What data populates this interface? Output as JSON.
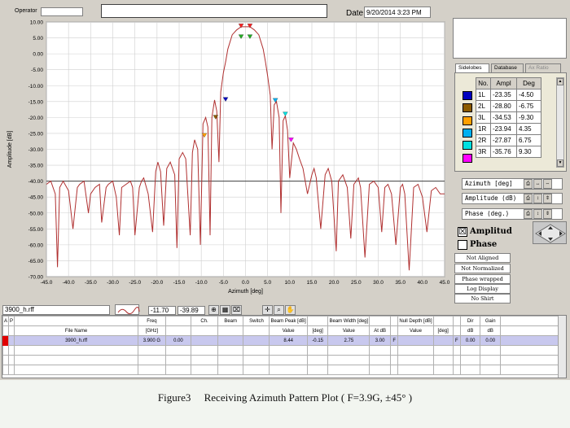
{
  "header": {
    "operator_label": "Operator",
    "operator_value": "",
    "title_value": "",
    "date_label": "Date",
    "date_value": "9/20/2014 3:23 PM"
  },
  "chart_data": {
    "type": "line",
    "xlabel": "Azimuth  [deg]",
    "ylabel": "Amplitude  [dB]",
    "xlim": [
      -45,
      45
    ],
    "ylim": [
      -70,
      10
    ],
    "xticks": [
      "-45.0",
      "-40.0",
      "-35.0",
      "-30.0",
      "-25.0",
      "-20.0",
      "-15.0",
      "-10.0",
      "-5.0",
      "0.0",
      "5.0",
      "10.0",
      "15.0",
      "20.0",
      "25.0",
      "30.0",
      "35.0",
      "40.0",
      "45.0"
    ],
    "yticks": [
      "10.00",
      "5.00",
      "0.00",
      "-5.00",
      "-10.00",
      "-15.00",
      "-20.00",
      "-25.00",
      "-30.00",
      "-35.00",
      "-40.00",
      "-45.00",
      "-50.00",
      "-55.00",
      "-60.00",
      "-65.00",
      "-70.00"
    ],
    "reference_line_y": -40,
    "grid": true,
    "series_color": "#b03030",
    "series": [
      {
        "x": [
          -45,
          -44,
          -43,
          -42.5,
          -42,
          -41.2,
          -40,
          -39,
          -38,
          -37.5,
          -36.5,
          -35.5,
          -35,
          -34,
          -33,
          -32.5,
          -31.5,
          -31,
          -30,
          -29.2,
          -28.5,
          -28,
          -27,
          -26,
          -25.5,
          -25,
          -24,
          -23.5,
          -23,
          -22,
          -21,
          -20.3,
          -19.8,
          -19.2,
          -18.5,
          -17.8,
          -17,
          -16,
          -15.5,
          -15,
          -14.2,
          -13.5,
          -12.5,
          -12,
          -11.5,
          -10.8,
          -10.2,
          -9.6,
          -9.0,
          -8.5,
          -8.0,
          -7.6,
          -7.0,
          -6.5,
          -6.0,
          -5.6,
          -5.0,
          -4.5,
          -4.0,
          -3.0,
          -2.0,
          -1.0,
          0,
          1.0,
          2.0,
          3.0,
          4.0,
          4.5,
          5.0,
          5.6,
          6.0,
          6.5,
          7.0,
          7.6,
          8.0,
          8.5,
          9.0,
          9.5,
          10.0,
          10.8,
          11.5,
          12.2,
          13,
          14,
          15,
          15.5,
          16,
          17,
          18,
          18.7,
          19.5,
          20.5,
          21,
          22,
          23,
          23.8,
          24.5,
          25.5,
          26,
          27,
          28,
          29,
          30,
          30.8,
          31.5,
          32.2,
          33,
          34,
          35,
          35.5,
          36,
          37,
          38,
          39,
          40,
          41,
          42,
          43,
          44,
          45
        ],
        "y": [
          -41,
          -40,
          -44,
          -67,
          -42,
          -40,
          -43,
          -55,
          -42,
          -41,
          -40,
          -50,
          -44,
          -42,
          -41,
          -53,
          -42,
          -41,
          -40,
          -45,
          -57,
          -42,
          -41,
          -40,
          -42,
          -57,
          -42,
          -40,
          -39,
          -44,
          -56,
          -37,
          -34,
          -37,
          -54,
          -36,
          -34,
          -38,
          -61,
          -33,
          -31,
          -33,
          -57,
          -31,
          -27,
          -30,
          -60,
          -22,
          -20,
          -23,
          -57,
          -20,
          -14.5,
          -18,
          -34,
          -12,
          -6,
          -2.5,
          1.5,
          6,
          7.5,
          8.5,
          8.5,
          8.5,
          7.5,
          6,
          1.5,
          -2.5,
          -7,
          -13,
          -30,
          -16,
          -15,
          -20,
          -50,
          -21,
          -19.5,
          -24,
          -39,
          -28,
          -30,
          -33,
          -36,
          -44,
          -38,
          -36,
          -39,
          -55,
          -38,
          -36,
          -40,
          -62,
          -40,
          -38,
          -42,
          -58,
          -41,
          -39,
          -42,
          -64,
          -41,
          -40,
          -42,
          -56,
          -42,
          -41,
          -44,
          -60,
          -42,
          -41,
          -44,
          -68,
          -42,
          -41,
          -45,
          -56,
          -43,
          -42,
          -44,
          -44
        ]
      }
    ],
    "markers": [
      {
        "x": -1.0,
        "y": 8.4,
        "color": "#ff2020",
        "shape": "down"
      },
      {
        "x": 1.0,
        "y": 8.4,
        "color": "#ff2020",
        "shape": "down"
      },
      {
        "x": -1.0,
        "y": 5.0,
        "color": "#22aa22",
        "shape": "down"
      },
      {
        "x": 1.0,
        "y": 5.0,
        "color": "#22aa22",
        "shape": "down"
      },
      {
        "x": -4.5,
        "y": -14.7,
        "color": "#0000c0",
        "shape": "down"
      },
      {
        "x": 6.75,
        "y": -15.0,
        "color": "#00b0f0",
        "shape": "down"
      },
      {
        "x": -6.75,
        "y": -20.3,
        "color": "#8b5a00",
        "shape": "down"
      },
      {
        "x": 9.0,
        "y": -19.3,
        "color": "#00e0e0",
        "shape": "down"
      },
      {
        "x": -9.3,
        "y": -26.0,
        "color": "#ffa000",
        "shape": "down"
      },
      {
        "x": 10.3,
        "y": -27.4,
        "color": "#ff00ff",
        "shape": "down"
      }
    ]
  },
  "sidelobes": {
    "tabs": [
      "Sidelobes",
      "Database",
      "Ax Ratio"
    ],
    "headers": [
      "No.",
      "Ampl",
      "Deg"
    ],
    "rows": [
      {
        "no": "1L",
        "ampl": "-23.35",
        "deg": "-4.50",
        "color": "#0000c0"
      },
      {
        "no": "2L",
        "ampl": "-28.80",
        "deg": "-6.75",
        "color": "#8b5a00"
      },
      {
        "no": "3L",
        "ampl": "-34.53",
        "deg": "-9.30",
        "color": "#ffa000"
      },
      {
        "no": "1R",
        "ampl": "-23.94",
        "deg": "4.35",
        "color": "#00b0f0"
      },
      {
        "no": "2R",
        "ampl": "-27.87",
        "deg": "6.75",
        "color": "#00e0e0"
      },
      {
        "no": "3R",
        "ampl": "-35.76",
        "deg": "9.30",
        "color": "#ff00ff"
      }
    ]
  },
  "axis_controls": [
    {
      "label": "Azimuth  [deg]"
    },
    {
      "label": "Amplitude (dB)"
    },
    {
      "label": "Phase (deg.)"
    }
  ],
  "display": {
    "amplitude_label": "Amplitud",
    "amplitude_checked": "☒",
    "phase_label": "Phase",
    "options": [
      "Not Aligned",
      "Not Normalized",
      "Phase wrapped",
      "Log Display",
      "No Shirt"
    ]
  },
  "toolbar": {
    "file_label": "3900_h.rff",
    "value1": "-11.70",
    "value2": "-39.89"
  },
  "grid_table": {
    "header_top": [
      "A",
      "P",
      "",
      "Freq",
      "",
      "Ch.",
      "Beam",
      "Switch",
      "Beam Peak [dB]",
      "",
      "Beam Width [deg]",
      "",
      "",
      "Null Depth [dB]",
      "",
      "",
      "Dir",
      "Gain"
    ],
    "header_sub": [
      "",
      "",
      "File Name",
      "[GHz]",
      "",
      "",
      "",
      "",
      "Value",
      "[deg]",
      "Value",
      "At dB",
      "",
      "Value",
      "[deg]",
      "",
      "dB",
      "dB"
    ],
    "rows": [
      [
        "",
        "",
        "3900_h.rff",
        "3.900 G",
        "0.00",
        "",
        "",
        "",
        "8.44",
        "-0.15",
        "2.75",
        "3.00",
        "F",
        "",
        "",
        "F",
        "0.00",
        "0.00"
      ]
    ]
  },
  "caption": "Figure3     Receiving Azimuth Pattern Plot ( F=3.9G, ±45° )"
}
